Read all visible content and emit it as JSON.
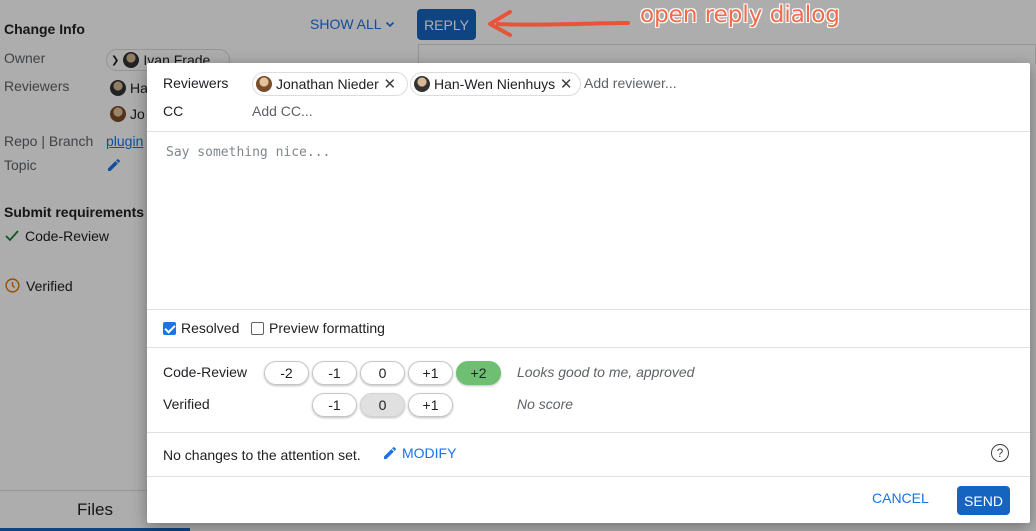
{
  "background": {
    "change_info": "Change Info",
    "owner_label": "Owner",
    "owner_name": "Ivan Frade",
    "reviewers_label": "Reviewers",
    "reviewer_1": "Ha",
    "reviewer_2": "Jo",
    "repo_branch_label": "Repo | Branch",
    "repo_link": "plugin",
    "topic_label": "Topic",
    "submit_requirements": "Submit requirements",
    "code_review_req": "Code-Review",
    "verified_req": "Verified",
    "show_all": "SHOW ALL",
    "reply_button": "REPLY",
    "annotation": "open reply dialog",
    "files_tab": "Files"
  },
  "dialog": {
    "reviewers_label": "Reviewers",
    "reviewers": [
      {
        "name": "Jonathan Nieder"
      },
      {
        "name": "Han-Wen Nienhuys"
      }
    ],
    "add_reviewer_placeholder": "Add reviewer...",
    "cc_label": "CC",
    "add_cc_placeholder": "Add CC...",
    "message_placeholder": "Say something nice...",
    "resolved_label": "Resolved",
    "resolved_checked": true,
    "preview_label": "Preview formatting",
    "preview_checked": false,
    "labels": [
      {
        "name": "Code-Review",
        "options": [
          "-2",
          "-1",
          "0",
          "+1",
          "+2"
        ],
        "selected": "+2",
        "description": "Looks good to me, approved"
      },
      {
        "name": "Verified",
        "options": [
          "-1",
          "0",
          "+1"
        ],
        "selected": "0",
        "description": "No score"
      }
    ],
    "attention_text": "No changes to the attention set.",
    "modify_label": "MODIFY",
    "help_icon": "?",
    "cancel_label": "CANCEL",
    "send_label": "SEND"
  },
  "colors": {
    "accent": "#1565c0",
    "link": "#1a73e8",
    "vote_positive": "#6fbf73",
    "annotation": "#f56a4a",
    "backdrop": "rgba(0,0,0,0.32)"
  }
}
